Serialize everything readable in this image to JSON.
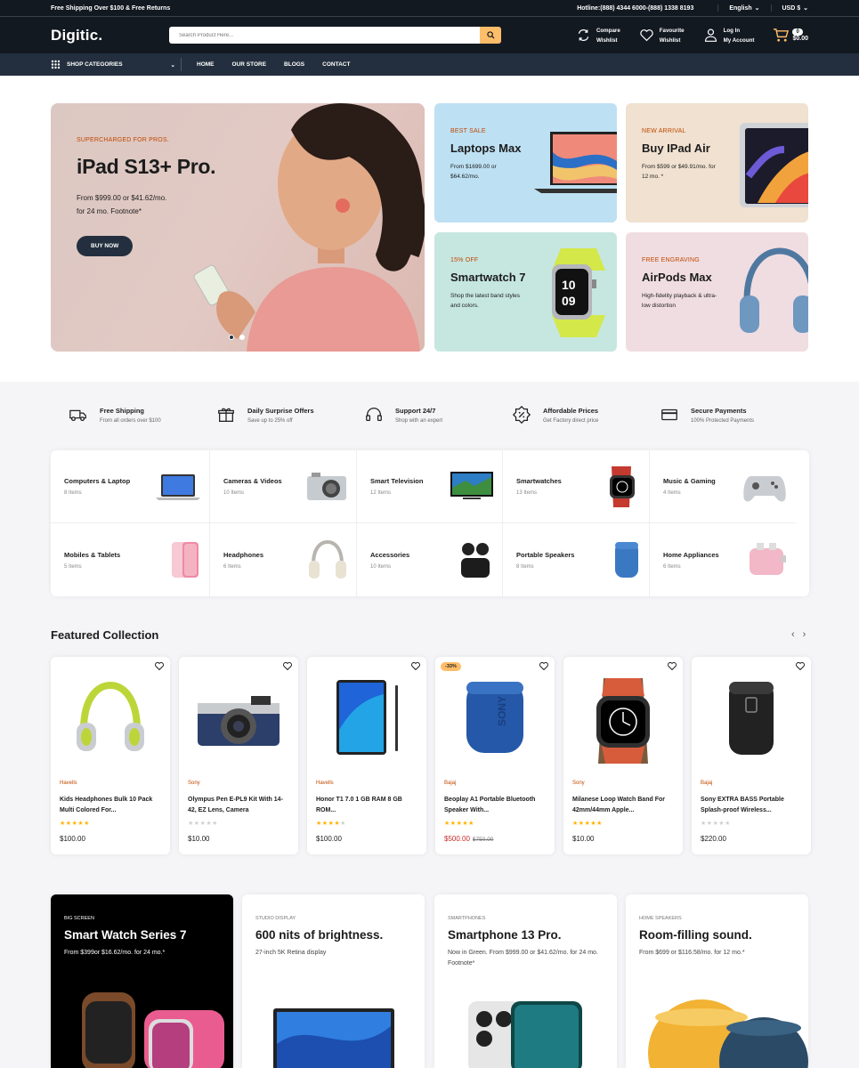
{
  "topbar": {
    "promo": "Free Shipping Over $100 & Free Returns",
    "hotline": "Hotline:(888) 4344 6000-(888) 1338 8193",
    "language": "English",
    "currency": "USD $"
  },
  "header": {
    "logo": "Digitic.",
    "search_placeholder": "Search Product Here...",
    "compare_l1": "Compare",
    "compare_l2": "Wishlist",
    "fav_l1": "Favourite",
    "fav_l2": "Wishlist",
    "account_l1": "Log In",
    "account_l2": "My Account",
    "cart_count": "0",
    "cart_total": "$0.00"
  },
  "nav": {
    "shop_categories": "SHOP CATEGORIES",
    "links": [
      "HOME",
      "OUR STORE",
      "BLOGS",
      "CONTACT"
    ]
  },
  "hero": {
    "kicker": "SUPERCHARGED FOR PROS.",
    "title": "iPad S13+ Pro.",
    "desc_l1": "From $999.00 or $41.62/mo.",
    "desc_l2": "for 24 mo. Footnote*",
    "button": "BUY NOW"
  },
  "small_banners": [
    {
      "kicker": "BEST SALE",
      "title": "Laptops Max",
      "desc": "From $1699.00 or $64.62/mo.",
      "bg": "#bde0f3"
    },
    {
      "kicker": "NEW ARRIVAL",
      "title": "Buy IPad Air",
      "desc": "From $599 or $49.91/mo. for 12 mo. *",
      "bg": "#f0e1d0"
    },
    {
      "kicker": "15% OFF",
      "title": "Smartwatch 7",
      "desc": "Shop the latest band styles and colors.",
      "bg": "#c6e6e0"
    },
    {
      "kicker": "FREE ENGRAVING",
      "title": "AirPods Max",
      "desc": "High-fidelity playback & ultra-low distortion",
      "bg": "#f0dde1"
    }
  ],
  "services": [
    {
      "title": "Free Shipping",
      "sub": "From all orders over $100",
      "icon": "truck-icon"
    },
    {
      "title": "Daily Surprise Offers",
      "sub": "Save up to 25% off",
      "icon": "gift-icon"
    },
    {
      "title": "Support 24/7",
      "sub": "Shop with an expert",
      "icon": "headset-icon"
    },
    {
      "title": "Affordable Prices",
      "sub": "Get Factory direct price",
      "icon": "discount-badge-icon"
    },
    {
      "title": "Secure Payments",
      "sub": "100% Protected Payments",
      "icon": "credit-card-icon"
    }
  ],
  "categories": [
    {
      "name": "Computers & Laptop",
      "count": "8 Items"
    },
    {
      "name": "Cameras & Videos",
      "count": "10 Items"
    },
    {
      "name": "Smart Television",
      "count": "12 Items"
    },
    {
      "name": "Smartwatches",
      "count": "13 Items"
    },
    {
      "name": "Music & Gaming",
      "count": "4 Items"
    },
    {
      "name": "Mobiles & Tablets",
      "count": "5 Items"
    },
    {
      "name": "Headphones",
      "count": "6 Items"
    },
    {
      "name": "Accessories",
      "count": "10 Items"
    },
    {
      "name": "Portable Speakers",
      "count": "8 Items"
    },
    {
      "name": "Home Appliances",
      "count": "6 Items"
    }
  ],
  "featured": {
    "title": "Featured Collection",
    "products": [
      {
        "brand": "Havells",
        "name": "Kids Headphones Bulk 10 Pack Multi Colored For...",
        "price": "$100.00",
        "old": "",
        "stars": 5,
        "discount": ""
      },
      {
        "brand": "Sony",
        "name": "Olympus Pen E-PL9 Kit With 14-42, EZ Lens, Camera",
        "price": "$10.00",
        "old": "",
        "stars": 0,
        "discount": ""
      },
      {
        "brand": "Havells",
        "name": "Honor T1 7.0 1 GB RAM 8 GB ROM...",
        "price": "$100.00",
        "old": "",
        "stars": 4,
        "discount": ""
      },
      {
        "brand": "Bajaj",
        "name": "Beoplay A1 Portable Bluetooth Speaker With...",
        "price": "$500.00",
        "old": "$750.00",
        "stars": 5,
        "discount": "-33%"
      },
      {
        "brand": "Sony",
        "name": "Milanese Loop Watch Band For 42mm/44mm Apple...",
        "price": "$10.00",
        "old": "",
        "stars": 5,
        "discount": ""
      },
      {
        "brand": "Bajaj",
        "name": "Sony EXTRA BASS Portable Splash-proof Wireless...",
        "price": "$220.00",
        "old": "",
        "stars": 0,
        "discount": ""
      }
    ]
  },
  "big_cards": [
    {
      "kicker": "BIG SCREEN",
      "title": "Smart Watch Series 7",
      "desc": "From $399or $16.62/mo. for 24 mo.*"
    },
    {
      "kicker": "STUDIO DISPLAY",
      "title": "600 nits of brightness.",
      "desc": "27-inch 5K Retina display"
    },
    {
      "kicker": "SMARTPHONES",
      "title": "Smartphone 13 Pro.",
      "desc": "Now in Green. From $999.00 or $41.62/mo. for 24 mo. Footnote*"
    },
    {
      "kicker": "HOME SPEAKERS",
      "title": "Room-filling sound.",
      "desc": "From $699 or $116.58/mo. for 12 mo.*"
    }
  ],
  "colors": {
    "dark": "#131921",
    "nav": "#232f3e",
    "accent": "#febd69",
    "sale": "#bf4800",
    "star": "#ffb400"
  }
}
